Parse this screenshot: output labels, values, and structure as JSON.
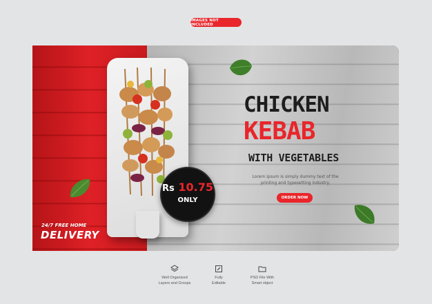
{
  "top_badge": "IMAGES NOT INCLUDED",
  "headline": {
    "line1": "CHICKEN",
    "line2": "KEBAB",
    "line3": "WITH VEGETABLES"
  },
  "body_text": {
    "line1": "Lorem ipsum is simply dummy text of the",
    "line2": "printing and typesetting industry."
  },
  "order_button": "ORDER NOW",
  "price": {
    "currency": "Rs",
    "amount": "10.75",
    "note": "ONLY"
  },
  "promo": {
    "small": "24/7 FREE HOME",
    "big": "DELIVERY"
  },
  "features": [
    {
      "line1": "Well Organized",
      "line2": "Layers and Groups"
    },
    {
      "line1": "Fully",
      "line2": "Editable"
    },
    {
      "line1": "PSD File With",
      "line2": "Smart object"
    }
  ],
  "colors": {
    "accent": "#e8262b",
    "dark": "#1d1d1d",
    "background": "#e3e4e6"
  },
  "icons": [
    "layers-icon",
    "edit-icon",
    "file-icon"
  ]
}
